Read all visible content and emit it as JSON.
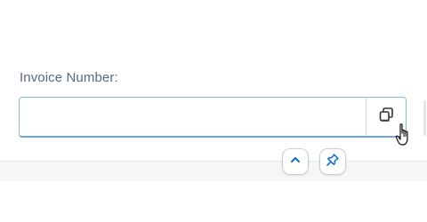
{
  "form": {
    "invoice_number": {
      "label": "Invoice Number:",
      "value": "",
      "placeholder": ""
    }
  },
  "icons": {
    "value_help": "copy-icon",
    "collapse": "chevron-up-icon",
    "pin": "pin-icon",
    "cursor": "hand-pointer-cursor"
  },
  "colors": {
    "accent": "#0a6ed1",
    "label": "#556b82",
    "field_border": "#89b7e8"
  }
}
